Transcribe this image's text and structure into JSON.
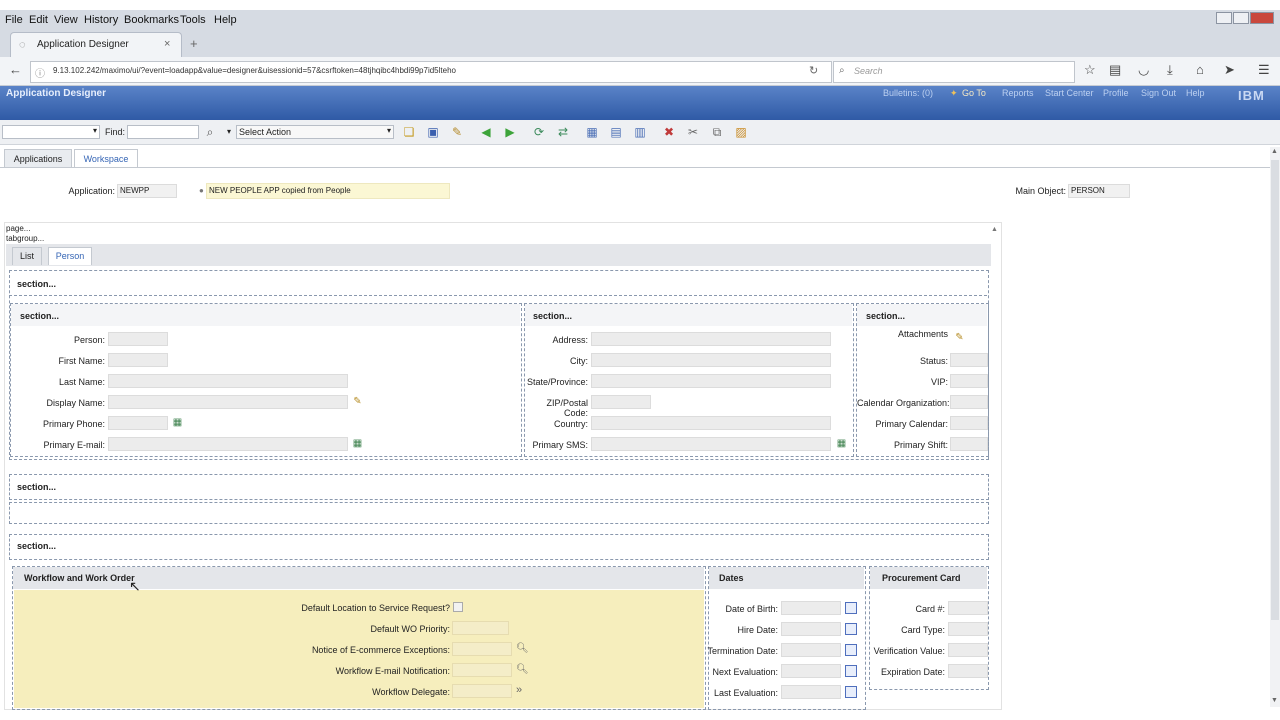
{
  "browser": {
    "menu": [
      "File",
      "Edit",
      "View",
      "History",
      "Bookmarks",
      "Tools",
      "Help"
    ],
    "tab_title": "Application Designer",
    "url": "9.13.102.242/maximo/ui/?event=loadapp&value=designer&uisessionid=57&csrftoken=48tjhqibc4hbdi99p7id5lteho",
    "search_placeholder": "Search"
  },
  "app": {
    "title": "Application Designer",
    "header_links": [
      "Bulletins: (0)",
      "Go To",
      "Reports",
      "Start Center",
      "Profile",
      "Sign Out",
      "Help"
    ],
    "brand": "IBM",
    "find_label": "Find:",
    "select_action": "Select Action",
    "tabs": [
      "Applications",
      "Workspace"
    ],
    "application_label": "Application:",
    "application_value": "NEWPP",
    "application_desc": "NEW PEOPLE APP copied from People",
    "main_object_label": "Main Object:",
    "main_object_value": "PERSON"
  },
  "canvas": {
    "page_label": "page...",
    "tabgroup_label": "tabgroup...",
    "inner_tabs": [
      "List",
      "Person"
    ],
    "section": "section...",
    "col1": [
      "Person:",
      "First Name:",
      "Last Name:",
      "Display Name:",
      "Primary Phone:",
      "Primary E-mail:"
    ],
    "col2": [
      "Address:",
      "City:",
      "State/Province:",
      "ZIP/Postal Code:",
      "Country:",
      "Primary SMS:"
    ],
    "col3": [
      "Attachments",
      "Status:",
      "VIP:",
      "Calendar Organization:",
      "Primary Calendar:",
      "Primary Shift:"
    ],
    "workflow_title": "Workflow and Work Order",
    "workflow": [
      "Default Location to Service Request?",
      "Default WO Priority:",
      "Notice of E-commerce Exceptions:",
      "Workflow E-mail Notification:",
      "Workflow Delegate:"
    ],
    "dates_title": "Dates",
    "dates": [
      "Date of Birth:",
      "Hire Date:",
      "Termination Date:",
      "Next Evaluation:",
      "Last Evaluation:"
    ],
    "proc_title": "Procurement Card",
    "proc": [
      "Card #:",
      "Card Type:",
      "Verification Value:",
      "Expiration Date:"
    ]
  }
}
